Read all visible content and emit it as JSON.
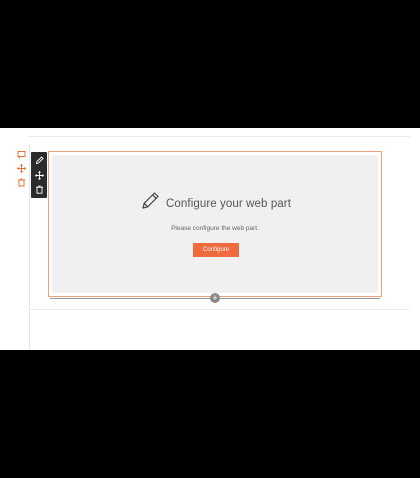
{
  "placeholder": {
    "title": "Configure your web part",
    "description": "Please configure the web part.",
    "button_label": "Configure"
  },
  "toolbar": {
    "items": [
      "pencil-icon",
      "move-icon",
      "delete-icon"
    ]
  },
  "section_rail": {
    "items": [
      "section-edit-icon",
      "section-move-icon",
      "section-delete-icon"
    ]
  },
  "add_button_label": "+",
  "colors": {
    "accent": "#ef6a3d",
    "frame_border": "#f0a07c",
    "toolbar_bg": "#2b2b2b",
    "placeholder_bg": "#f0f0f0"
  }
}
